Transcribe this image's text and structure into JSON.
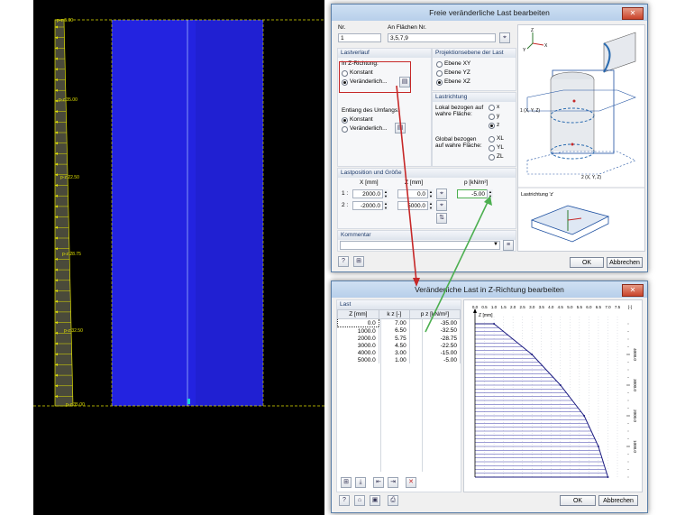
{
  "viewport": {
    "labels": [
      "p-z:35.00",
      "p-z:22.50",
      "p-z:28.75",
      "p-z:32.50",
      "p-z:35.00",
      "p-z:5.00"
    ]
  },
  "dialog1": {
    "title": "Freie veränderliche Last bearbeiten",
    "nr_label": "Nr.",
    "nr_value": "1",
    "flaechen_label": "An Flächen Nr.",
    "flaechen_value": "3,5,7,9",
    "lastverlauf": {
      "header": "Lastverlauf",
      "sub": "In Z-Richtung:",
      "options": [
        "Konstant",
        "Veränderlich..."
      ],
      "selected": 1
    },
    "umfang": {
      "sub": "Entlang des Umfangs:",
      "options": [
        "Konstant",
        "Veränderlich..."
      ],
      "selected": 0
    },
    "projektion": {
      "header": "Projektionsebene der Last",
      "options": [
        "Ebene XY",
        "Ebene YZ",
        "Ebene XZ"
      ],
      "selected": 2
    },
    "lastrichtung": {
      "header": "Lastrichtung",
      "lokal_label": "Lokal bezogen auf wahre Fläche:",
      "lokal_options": [
        "x",
        "y",
        "z"
      ],
      "lokal_selected": 2,
      "global_label": "Global bezogen auf wahre Fläche:",
      "global_options": [
        "XL",
        "YL",
        "ZL"
      ]
    },
    "lastposition": {
      "header": "Lastposition und Größe",
      "col_x": "X [mm]",
      "col_z": "Z [mm]",
      "col_p": "p [kN/m²]",
      "rows": [
        {
          "idx": "1 :",
          "x": "2000.0",
          "z": "0.0",
          "p": "-5.00"
        },
        {
          "idx": "2 :",
          "x": "-2000.0",
          "z": "5000.0",
          "p": ""
        }
      ]
    },
    "kommentar_header": "Kommentar",
    "preview": {
      "label1": "1 (X, Y, Z)",
      "label2": "2 (X, Y, Z)",
      "caption": "Lastrichtung 'z'",
      "axis_z": "Z",
      "axis_x": "X",
      "axis_y": "Y"
    },
    "ok": "OK",
    "cancel": "Abbrechen"
  },
  "dialog2": {
    "title": "Veränderliche Last in Z-Richtung bearbeiten",
    "group_header": "Last",
    "col_z": "Z [mm]",
    "col_k": "k z [-]",
    "col_p": "p z [kN/m²]",
    "rows": [
      {
        "z": "0.0",
        "k": "7.00",
        "p": "-35.00"
      },
      {
        "z": "1000.0",
        "k": "6.50",
        "p": "-32.50"
      },
      {
        "z": "2000.0",
        "k": "5.75",
        "p": "-28.75"
      },
      {
        "z": "3000.0",
        "k": "4.50",
        "p": "-22.50"
      },
      {
        "z": "4000.0",
        "k": "3.00",
        "p": "-15.00"
      },
      {
        "z": "5000.0",
        "k": "1.00",
        "p": "-5.00"
      }
    ],
    "chart_axis_z": "Z [mm]",
    "chart_x_unit": "[-]",
    "chart_y_ticks": [
      "4000.0",
      "3000.0",
      "2000.0",
      "1000.0"
    ],
    "chart_x_ticks": [
      "0.0",
      "0.5",
      "1.0",
      "1.5",
      "2.0",
      "2.5",
      "3.0",
      "3.5",
      "4.0",
      "4.5",
      "5.0",
      "5.5",
      "6.0",
      "6.5",
      "7.0",
      "7.5"
    ],
    "ok": "OK",
    "cancel": "Abbrechen"
  },
  "chart_data": {
    "type": "area",
    "x": [
      0,
      1000,
      2000,
      3000,
      4000,
      5000
    ],
    "series": [
      {
        "values": [
          7.0,
          6.5,
          5.75,
          4.5,
          3.0,
          1.0
        ]
      }
    ],
    "xlabel": "Z [mm]",
    "ylabel": "[-]",
    "xlim": [
      0,
      5000
    ],
    "ylim": [
      0,
      7.5
    ]
  }
}
